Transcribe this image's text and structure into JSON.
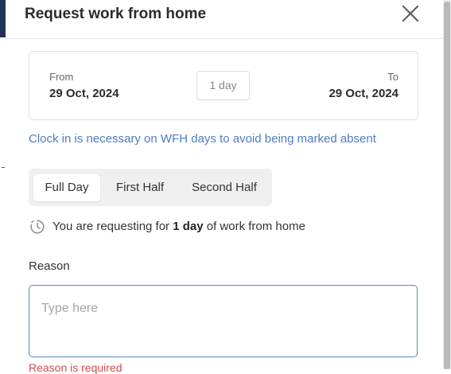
{
  "modal": {
    "title": "Request work from home",
    "close_icon": "close-icon"
  },
  "date_range": {
    "from_label": "From",
    "from_date": "29 Oct, 2024",
    "duration": "1 day",
    "to_label": "To",
    "to_date": "29 Oct, 2024"
  },
  "notice": "Clock in is necessary on WFH days to avoid being marked absent",
  "day_type": {
    "options": [
      "Full Day",
      "First Half",
      "Second Half"
    ],
    "selected": "Full Day"
  },
  "summary": {
    "icon": "clock-history-icon",
    "prefix": "You are requesting for ",
    "highlight": "1 day",
    "suffix": " of work from home"
  },
  "reason": {
    "label": "Reason",
    "placeholder": "Type here",
    "value": "",
    "error": "Reason is required"
  },
  "colors": {
    "accent": "#4f7dbf",
    "error": "#d34a4a",
    "segment_bg": "#efefef"
  }
}
